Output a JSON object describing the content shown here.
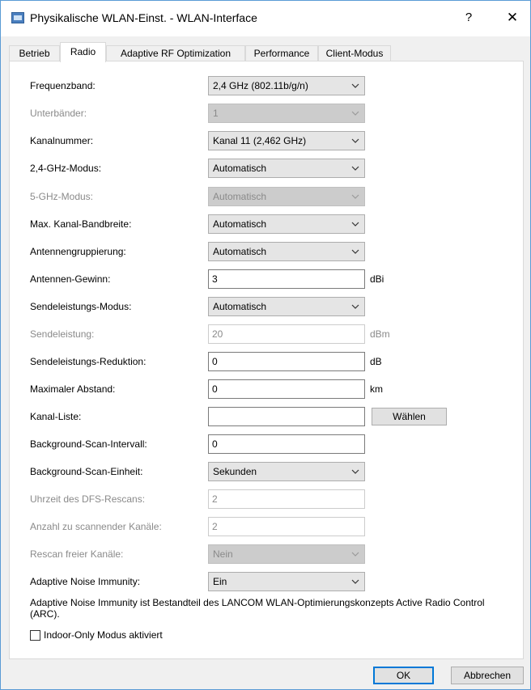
{
  "window": {
    "title": "Physikalische WLAN-Einst. - WLAN-Interface",
    "help_label": "?",
    "close_label": "✕"
  },
  "tabs": [
    {
      "label": "Betrieb",
      "active": false
    },
    {
      "label": "Radio",
      "active": true
    },
    {
      "label": "Adaptive RF Optimization",
      "active": false
    },
    {
      "label": "Performance",
      "active": false
    },
    {
      "label": "Client-Modus",
      "active": false
    }
  ],
  "form": {
    "frequenzband": {
      "label": "Frequenzband:",
      "value": "2,4 GHz (802.11b/g/n)"
    },
    "unterbaender": {
      "label": "Unterbänder:",
      "value": "1"
    },
    "kanalnummer": {
      "label": "Kanalnummer:",
      "value": "Kanal 11 (2,462 GHz)"
    },
    "modus_24": {
      "label": "2,4-GHz-Modus:",
      "value": "Automatisch"
    },
    "modus_5": {
      "label": "5-GHz-Modus:",
      "value": "Automatisch"
    },
    "kanal_bandbreite": {
      "label": "Max. Kanal-Bandbreite:",
      "value": "Automatisch"
    },
    "antennengruppierung": {
      "label": "Antennengruppierung:",
      "value": "Automatisch"
    },
    "antennen_gewinn": {
      "label": "Antennen-Gewinn:",
      "value": "3",
      "unit": "dBi"
    },
    "sendeleistungs_modus": {
      "label": "Sendeleistungs-Modus:",
      "value": "Automatisch"
    },
    "sendeleistung": {
      "label": "Sendeleistung:",
      "value": "20",
      "unit": "dBm"
    },
    "sendeleistungs_reduktion": {
      "label": "Sendeleistungs-Reduktion:",
      "value": "0",
      "unit": "dB"
    },
    "maximaler_abstand": {
      "label": "Maximaler Abstand:",
      "value": "0",
      "unit": "km"
    },
    "kanal_liste": {
      "label": "Kanal-Liste:",
      "value": "",
      "button_label": "Wählen"
    },
    "bg_scan_intervall": {
      "label": "Background-Scan-Intervall:",
      "value": "0"
    },
    "bg_scan_einheit": {
      "label": "Background-Scan-Einheit:",
      "value": "Sekunden"
    },
    "dfs_rescan": {
      "label": "Uhrzeit des DFS-Rescans:",
      "value": "2"
    },
    "anzahl_kanaele": {
      "label": "Anzahl zu scannender Kanäle:",
      "value": "2"
    },
    "rescan_freier": {
      "label": "Rescan freier Kanäle:",
      "value": "Nein"
    },
    "noise_immunity": {
      "label": "Adaptive Noise Immunity:",
      "value": "Ein"
    }
  },
  "info_text": "Adaptive Noise Immunity ist Bestandteil des LANCOM WLAN-Optimierungskonzepts Active Radio Control (ARC).",
  "indoor_only": {
    "label": "Indoor-Only Modus aktiviert",
    "checked": false
  },
  "footer": {
    "ok_label": "OK",
    "cancel_label": "Abbrechen"
  },
  "icons": {
    "app": "app-window-icon",
    "dropdown": "chevron-down-icon"
  }
}
